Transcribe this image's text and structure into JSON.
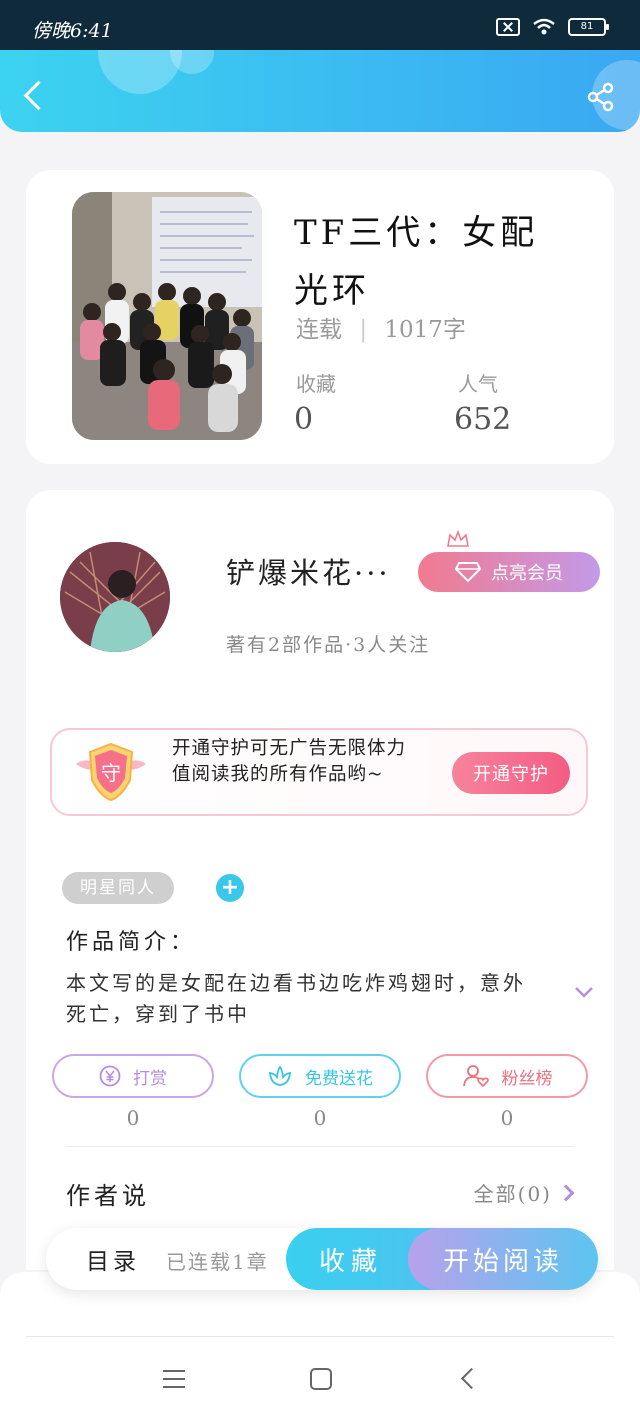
{
  "status_bar": {
    "time": "傍晚6:41",
    "battery": "81"
  },
  "book": {
    "title_line1": "TF三代：女配",
    "title_line2": "光环",
    "status": "连载",
    "word_count": "1017字",
    "favorites_label": "收藏",
    "favorites_value": "0",
    "popularity_label": "人气",
    "popularity_value": "652"
  },
  "author": {
    "name": "铲爆米花···",
    "vip_label": "点亮会员",
    "meta": "著有2部作品·3人关注"
  },
  "guard": {
    "badge": "守",
    "text": "开通守护可无广告无限体力值阅读我的所有作品哟~",
    "button": "开通守护"
  },
  "tag": {
    "label": "明星同人",
    "add": "+"
  },
  "intro": {
    "title": "作品简介：",
    "text": "本文写的是女配在边看书边吃炸鸡翅时，意外死亡，穿到了书中"
  },
  "actions": [
    {
      "label": "打赏",
      "count": "0",
      "color": "#b78be0",
      "icon": "yen-icon"
    },
    {
      "label": "免费送花",
      "count": "0",
      "color": "#38c6e6",
      "icon": "flower-icon"
    },
    {
      "label": "粉丝榜",
      "count": "0",
      "color": "#ef6f7f",
      "icon": "fan-rank-icon"
    }
  ],
  "author_says": {
    "title": "作者说",
    "all": "全部(0)"
  },
  "bottom_bar": {
    "toc": "目录",
    "chapters": "已连载1章",
    "favorite": "收藏",
    "read": "开始阅读"
  },
  "colors": {
    "header_start": "#3cd3f0",
    "header_end": "#3aa8f2",
    "accent_pink": "#f35c84",
    "accent_blue": "#39c8ea"
  }
}
